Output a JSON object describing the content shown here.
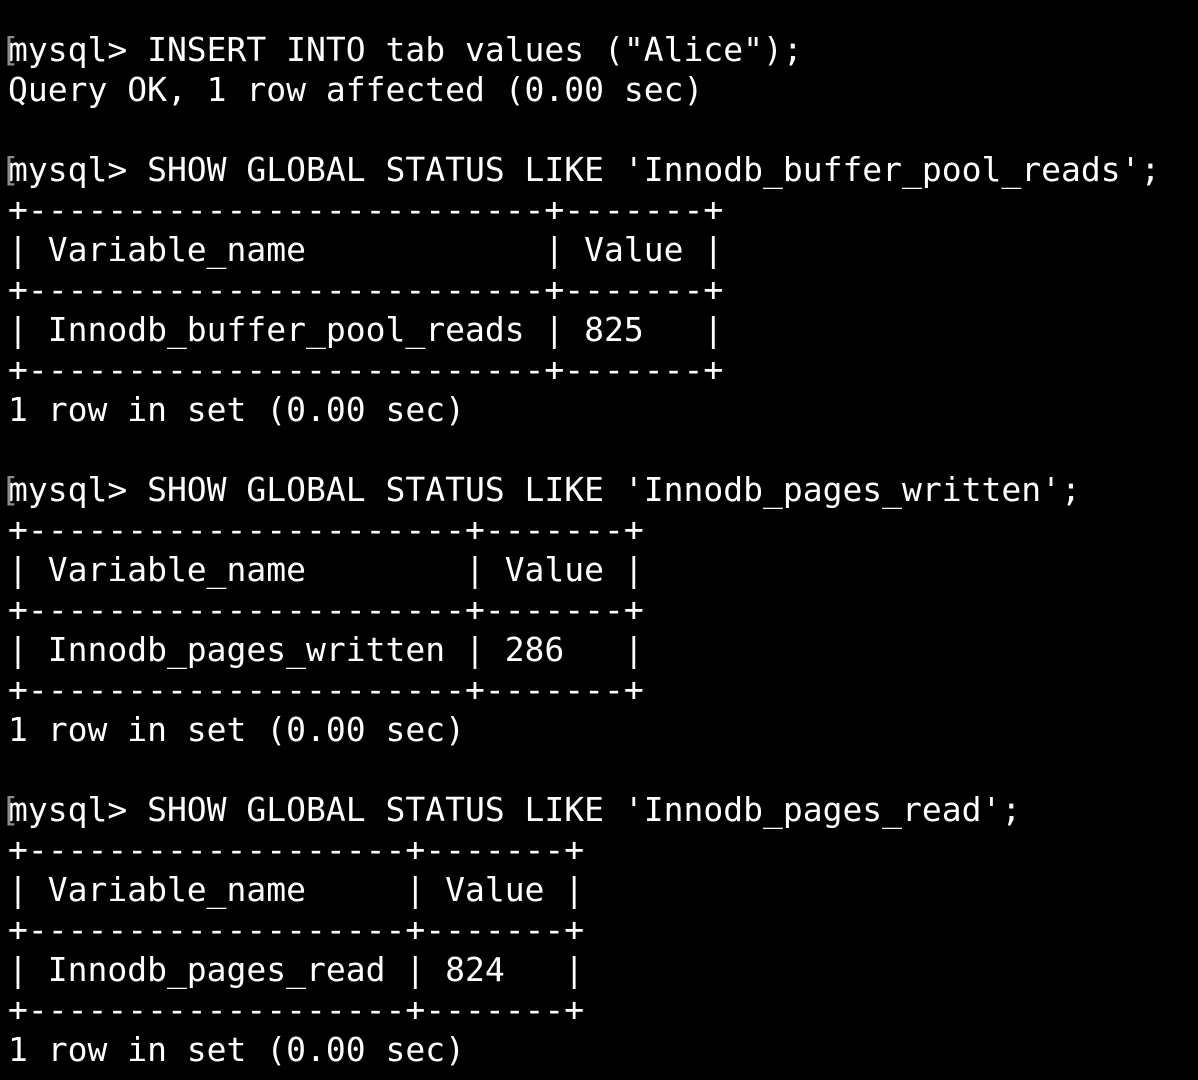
{
  "terminal": {
    "background": "#000000",
    "foreground": "#ffffff",
    "lines": [
      {
        "kind": "prompt",
        "text": "mysql> INSERT INTO tab values (\"Alice\");"
      },
      {
        "kind": "output",
        "text": "Query OK, 1 row affected (0.00 sec)"
      },
      {
        "kind": "blank",
        "text": ""
      },
      {
        "kind": "prompt",
        "text": "mysql> SHOW GLOBAL STATUS LIKE 'Innodb_buffer_pool_reads';"
      },
      {
        "kind": "border",
        "text": "+--------------------------+-------+"
      },
      {
        "kind": "table-header",
        "text": "| Variable_name            | Value |"
      },
      {
        "kind": "border",
        "text": "+--------------------------+-------+"
      },
      {
        "kind": "table-row",
        "text": "| Innodb_buffer_pool_reads | 825   |"
      },
      {
        "kind": "border",
        "text": "+--------------------------+-------+"
      },
      {
        "kind": "output",
        "text": "1 row in set (0.00 sec)"
      },
      {
        "kind": "blank",
        "text": ""
      },
      {
        "kind": "prompt",
        "text": "mysql> SHOW GLOBAL STATUS LIKE 'Innodb_pages_written';"
      },
      {
        "kind": "border",
        "text": "+----------------------+-------+"
      },
      {
        "kind": "table-header",
        "text": "| Variable_name        | Value |"
      },
      {
        "kind": "border",
        "text": "+----------------------+-------+"
      },
      {
        "kind": "table-row",
        "text": "| Innodb_pages_written | 286   |"
      },
      {
        "kind": "border",
        "text": "+----------------------+-------+"
      },
      {
        "kind": "output",
        "text": "1 row in set (0.00 sec)"
      },
      {
        "kind": "blank",
        "text": ""
      },
      {
        "kind": "prompt",
        "text": "mysql> SHOW GLOBAL STATUS LIKE 'Innodb_pages_read';"
      },
      {
        "kind": "border",
        "text": "+-------------------+-------+"
      },
      {
        "kind": "table-header",
        "text": "| Variable_name     | Value |"
      },
      {
        "kind": "border",
        "text": "+-------------------+-------+"
      },
      {
        "kind": "table-row",
        "text": "| Innodb_pages_read | 824   |"
      },
      {
        "kind": "border",
        "text": "+-------------------+-------+"
      },
      {
        "kind": "output",
        "text": "1 row in set (0.00 sec)"
      }
    ]
  }
}
